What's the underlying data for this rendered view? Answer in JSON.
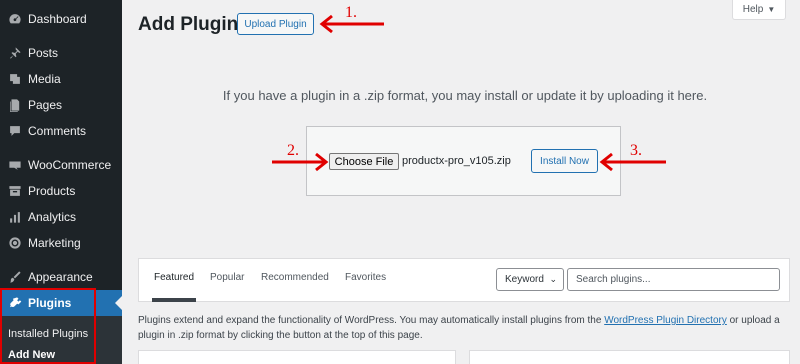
{
  "sidebar": {
    "items": [
      {
        "label": "Dashboard",
        "icon": "dashboard-icon"
      },
      {
        "label": "Posts",
        "icon": "pin-icon"
      },
      {
        "label": "Media",
        "icon": "media-icon"
      },
      {
        "label": "Pages",
        "icon": "pages-icon"
      },
      {
        "label": "Comments",
        "icon": "comment-icon"
      },
      {
        "label": "WooCommerce",
        "icon": "woocommerce-icon"
      },
      {
        "label": "Products",
        "icon": "archive-icon"
      },
      {
        "label": "Analytics",
        "icon": "bar-chart-icon"
      },
      {
        "label": "Marketing",
        "icon": "megaphone-icon"
      },
      {
        "label": "Appearance",
        "icon": "paintbrush-icon"
      },
      {
        "label": "Plugins",
        "icon": "plugin-icon"
      }
    ],
    "submenu": {
      "installed": "Installed Plugins",
      "add_new": "Add New"
    }
  },
  "header": {
    "title": "Add Plugins",
    "upload_button": "Upload Plugin",
    "help": "Help"
  },
  "upload": {
    "description": "If you have a plugin in a .zip format, you may install or update it by uploading it here.",
    "choose_file": "Choose File",
    "file_name": "productx-pro_v105.zip",
    "install_button": "Install Now"
  },
  "annotations": {
    "step1": "1.",
    "step2": "2.",
    "step3": "3.",
    "color": "#e00000"
  },
  "filter": {
    "tabs": [
      "Featured",
      "Popular",
      "Recommended",
      "Favorites"
    ],
    "active_tab": "Featured",
    "search_type": "Keyword",
    "search_placeholder": "Search plugins..."
  },
  "directory": {
    "text_before": "Plugins extend and expand the functionality of WordPress. You may automatically install plugins from the ",
    "link": "WordPress Plugin Directory",
    "text_after": " or upload a plugin in .zip format by clicking the button at the top of this page."
  },
  "colors": {
    "accent": "#2271b1",
    "sidebar_bg": "#1d2327",
    "highlight": "#e00000"
  }
}
